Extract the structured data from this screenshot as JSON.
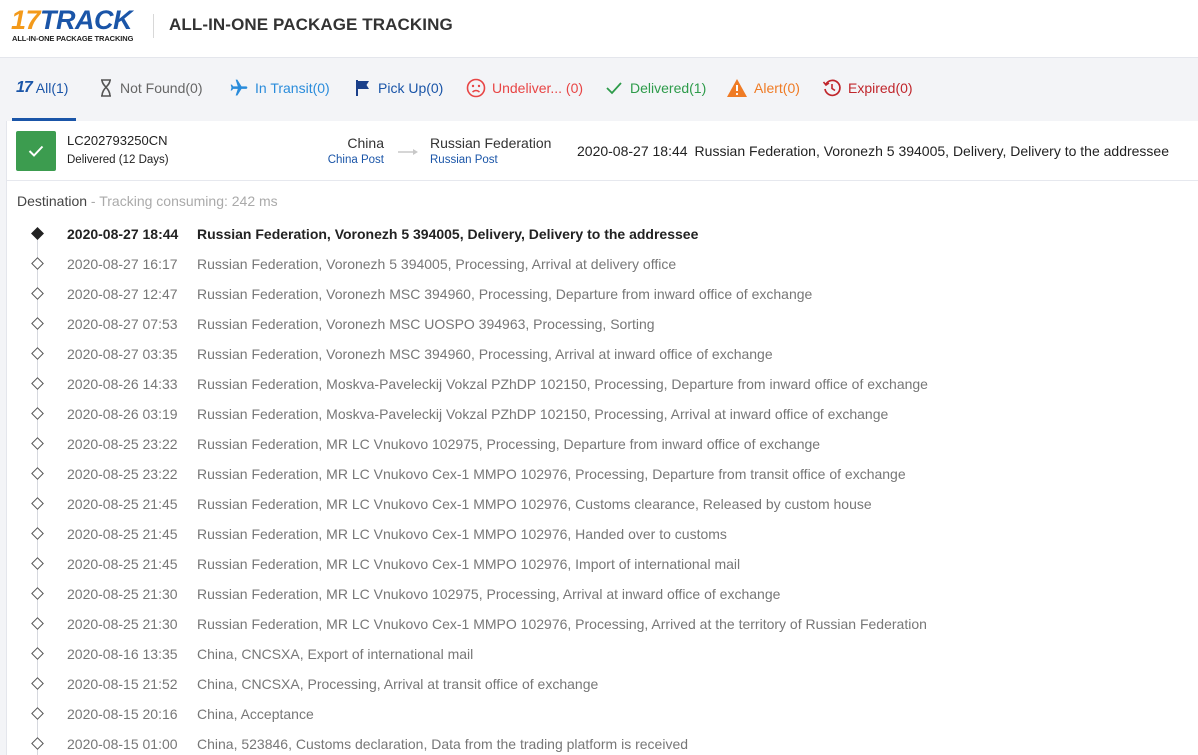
{
  "header": {
    "logo_text_17": "17",
    "logo_text_track": "TRACK",
    "logo_tagline": "ALL-IN-ONE PACKAGE TRACKING",
    "title": "ALL-IN-ONE PACKAGE TRACKING"
  },
  "tabs": {
    "all": {
      "label": "All",
      "count": "(1)"
    },
    "not_found": {
      "label": "Not Found(0)"
    },
    "in_transit": {
      "label": "In Transit(0)"
    },
    "pick_up": {
      "label": "Pick Up(0)"
    },
    "undelivered": {
      "label": "Undeliver... (0)"
    },
    "delivered": {
      "label": "Delivered(1)"
    },
    "alert": {
      "label": "Alert(0)"
    },
    "expired": {
      "label": "Expired(0)"
    }
  },
  "colors": {
    "brand_blue": "#1a55a8",
    "brand_orange": "#f39a1b",
    "delivered_green": "#3c9c4f",
    "undelivered_red": "#e84545",
    "alert_orange": "#ef7b25",
    "expired_red": "#c0262c"
  },
  "shipment": {
    "tracking_number": "LC202793250CN",
    "status": "Delivered (12 Days)",
    "status_icon": "check-icon",
    "origin_country": "China",
    "origin_carrier": "China Post",
    "destination_country": "Russian Federation",
    "destination_carrier": "Russian Post",
    "latest_time": "2020-08-27 18:44",
    "latest_event": "Russian Federation, Voronezh 5 394005, Delivery, Delivery to the addressee"
  },
  "destination_section": {
    "label": "Destination",
    "consuming": " - Tracking consuming: 242 ms"
  },
  "events": [
    {
      "time": "2020-08-27 18:44",
      "desc": "Russian Federation, Voronezh 5 394005, Delivery, Delivery to the addressee"
    },
    {
      "time": "2020-08-27 16:17",
      "desc": "Russian Federation, Voronezh 5 394005, Processing, Arrival at delivery office"
    },
    {
      "time": "2020-08-27 12:47",
      "desc": "Russian Federation, Voronezh MSC 394960, Processing, Departure from inward office of exchange"
    },
    {
      "time": "2020-08-27 07:53",
      "desc": "Russian Federation, Voronezh MSC UOSPO 394963, Processing, Sorting"
    },
    {
      "time": "2020-08-27 03:35",
      "desc": "Russian Federation, Voronezh MSC 394960, Processing, Arrival at inward office of exchange"
    },
    {
      "time": "2020-08-26 14:33",
      "desc": "Russian Federation, Moskva-Paveleckij Vokzal PZhDP 102150, Processing, Departure from inward office of exchange"
    },
    {
      "time": "2020-08-26 03:19",
      "desc": "Russian Federation, Moskva-Paveleckij Vokzal PZhDP 102150, Processing, Arrival at inward office of exchange"
    },
    {
      "time": "2020-08-25 23:22",
      "desc": "Russian Federation, MR LC Vnukovo 102975, Processing, Departure from inward office of exchange"
    },
    {
      "time": "2020-08-25 23:22",
      "desc": "Russian Federation, MR LC Vnukovo Cex-1 MMPO 102976, Processing, Departure from transit office of exchange"
    },
    {
      "time": "2020-08-25 21:45",
      "desc": "Russian Federation, MR LC Vnukovo Cex-1 MMPO 102976, Customs clearance, Released by custom house"
    },
    {
      "time": "2020-08-25 21:45",
      "desc": "Russian Federation, MR LC Vnukovo Cex-1 MMPO 102976, Handed over to customs"
    },
    {
      "time": "2020-08-25 21:45",
      "desc": "Russian Federation, MR LC Vnukovo Cex-1 MMPO 102976, Import of international mail"
    },
    {
      "time": "2020-08-25 21:30",
      "desc": "Russian Federation, MR LC Vnukovo 102975, Processing, Arrival at inward office of exchange"
    },
    {
      "time": "2020-08-25 21:30",
      "desc": "Russian Federation, MR LC Vnukovo Cex-1 MMPO 102976, Processing, Arrived at the territory of Russian Federation"
    },
    {
      "time": "2020-08-16 13:35",
      "desc": "China, CNCSXA, Export of international mail"
    },
    {
      "time": "2020-08-15 21:52",
      "desc": "China, CNCSXA, Processing, Arrival at transit office of exchange"
    },
    {
      "time": "2020-08-15 20:16",
      "desc": "China, Acceptance"
    },
    {
      "time": "2020-08-15 01:00",
      "desc": "China, 523846, Customs declaration, Data from the trading platform is received"
    }
  ]
}
